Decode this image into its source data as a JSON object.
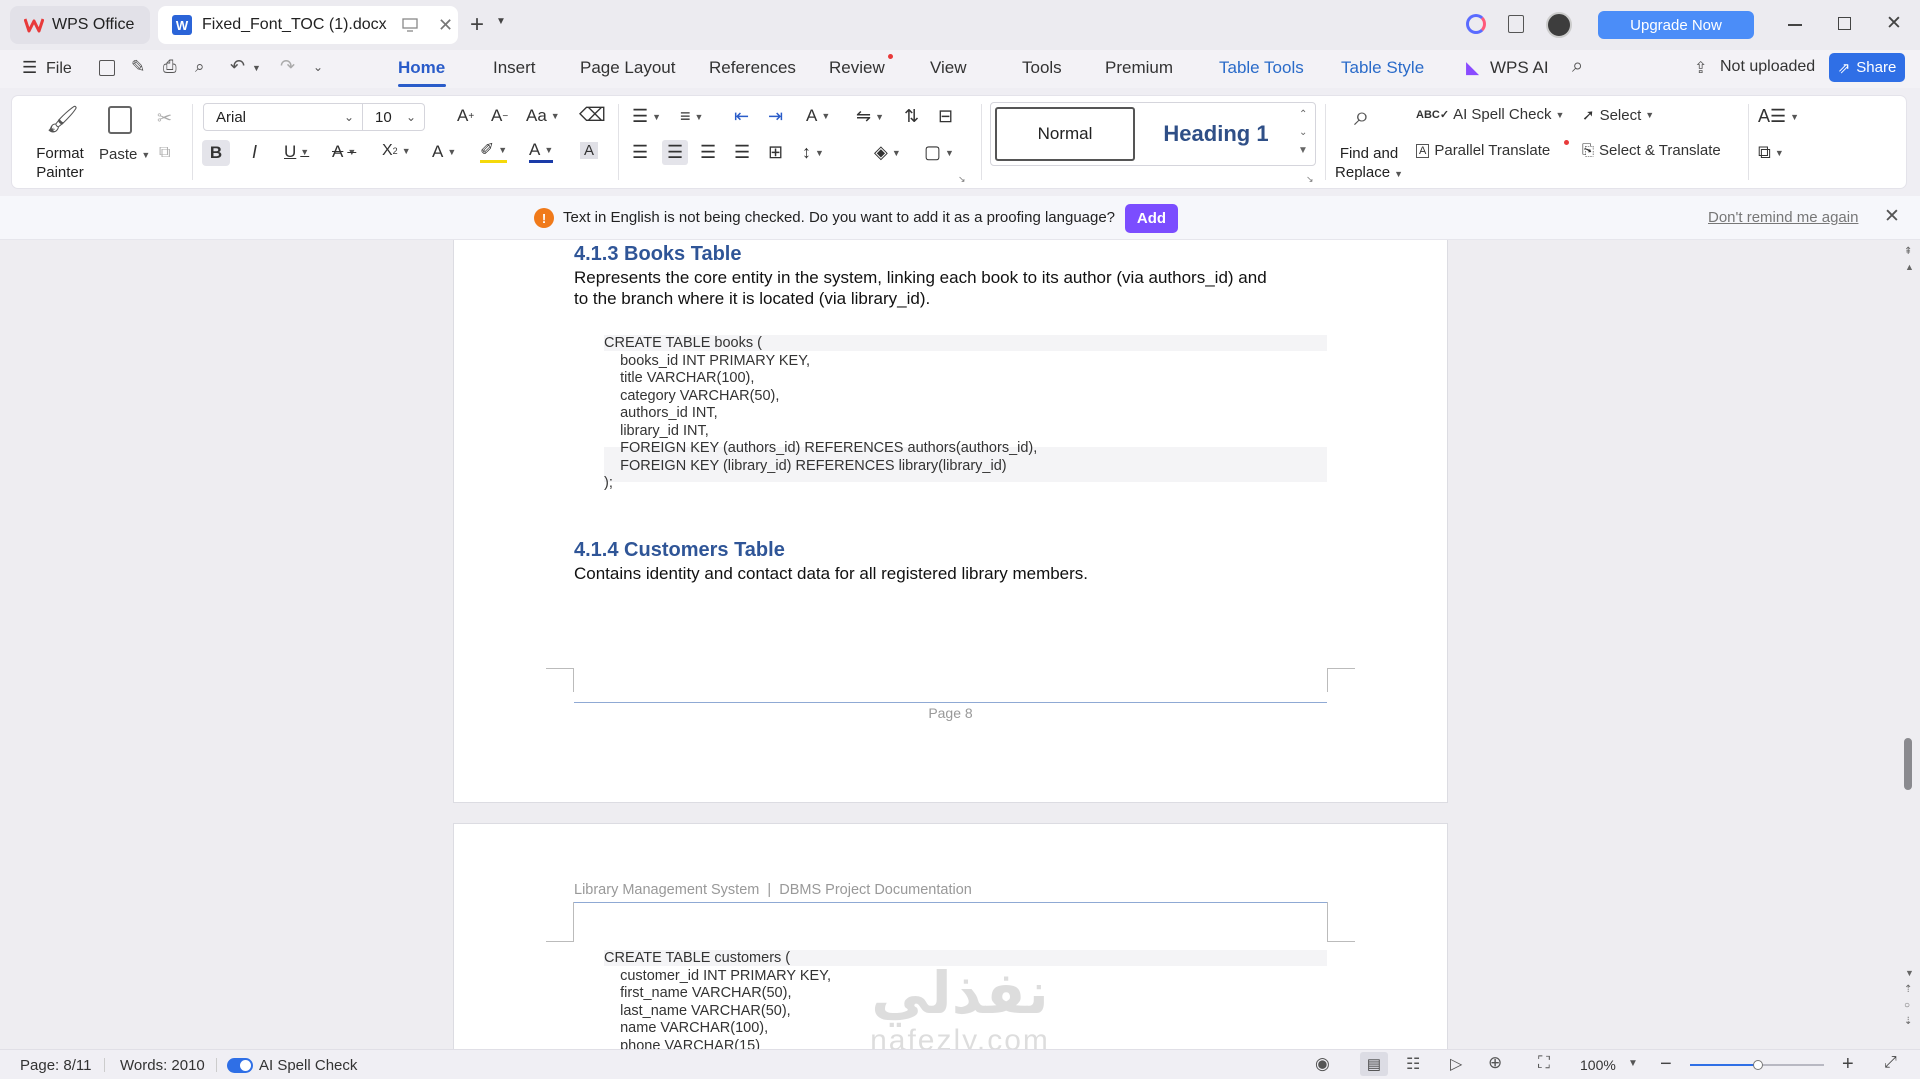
{
  "titlebar": {
    "app_tab": "WPS Office",
    "doc_tab": "Fixed_Font_TOC (1).docx",
    "upgrade": "Upgrade Now",
    "colors": {
      "upgrade_bg": "#4b8df8",
      "wps_red": "#e83a3a"
    }
  },
  "menu": {
    "file": "File",
    "items": [
      "Home",
      "Insert",
      "Page Layout",
      "References",
      "Review",
      "View",
      "Tools",
      "Premium",
      "Table Tools",
      "Table Style",
      "WPS AI"
    ],
    "not_uploaded": "Not uploaded",
    "share": "Share"
  },
  "ribbon": {
    "format_painter": [
      "Format",
      "Painter"
    ],
    "paste": "Paste",
    "font_name": "Arial",
    "font_size": "10",
    "style_normal": "Normal",
    "style_heading": "Heading 1",
    "find_replace": [
      "Find and",
      "Replace"
    ],
    "ai_spell_check": "AI Spell Check",
    "parallel_translate": "Parallel Translate",
    "select": "Select",
    "select_translate": "Select & Translate"
  },
  "notice": {
    "text": "Text in English is not being checked. Do you want to add it as a proofing language?",
    "add": "Add",
    "dont_remind": "Don't remind me again"
  },
  "document": {
    "h_books": "4.1.3 Books Table",
    "p_books_1": "Represents the core entity in the system, linking each book to its author (via authors_id) and",
    "p_books_2": "to the branch where it is located (via library_id).",
    "code_books": [
      "CREATE TABLE books (",
      "    books_id INT PRIMARY KEY,",
      "    title VARCHAR(100),",
      "    category VARCHAR(50),",
      "    authors_id INT,",
      "    library_id INT,",
      "    FOREIGN KEY (authors_id) REFERENCES authors(authors_id),",
      "    FOREIGN KEY (library_id) REFERENCES library(library_id)",
      ");"
    ],
    "h_customers": "4.1.4 Customers Table",
    "p_customers": "Contains identity and contact data for all registered library members.",
    "footer": "Page 8",
    "header_next": "Library Management System  |  DBMS Project Documentation",
    "code_customers": [
      "CREATE TABLE customers (",
      "    customer_id INT PRIMARY KEY,",
      "    first_name VARCHAR(50),",
      "    last_name VARCHAR(50),",
      "    name VARCHAR(100),",
      "    phone VARCHAR(15)"
    ]
  },
  "watermark": {
    "arabic": "نفذلي",
    "latin": "nafezly.com"
  },
  "status": {
    "page": "Page: 8/11",
    "words": "Words: 2010",
    "spell": "AI Spell Check",
    "zoom": "100%"
  }
}
